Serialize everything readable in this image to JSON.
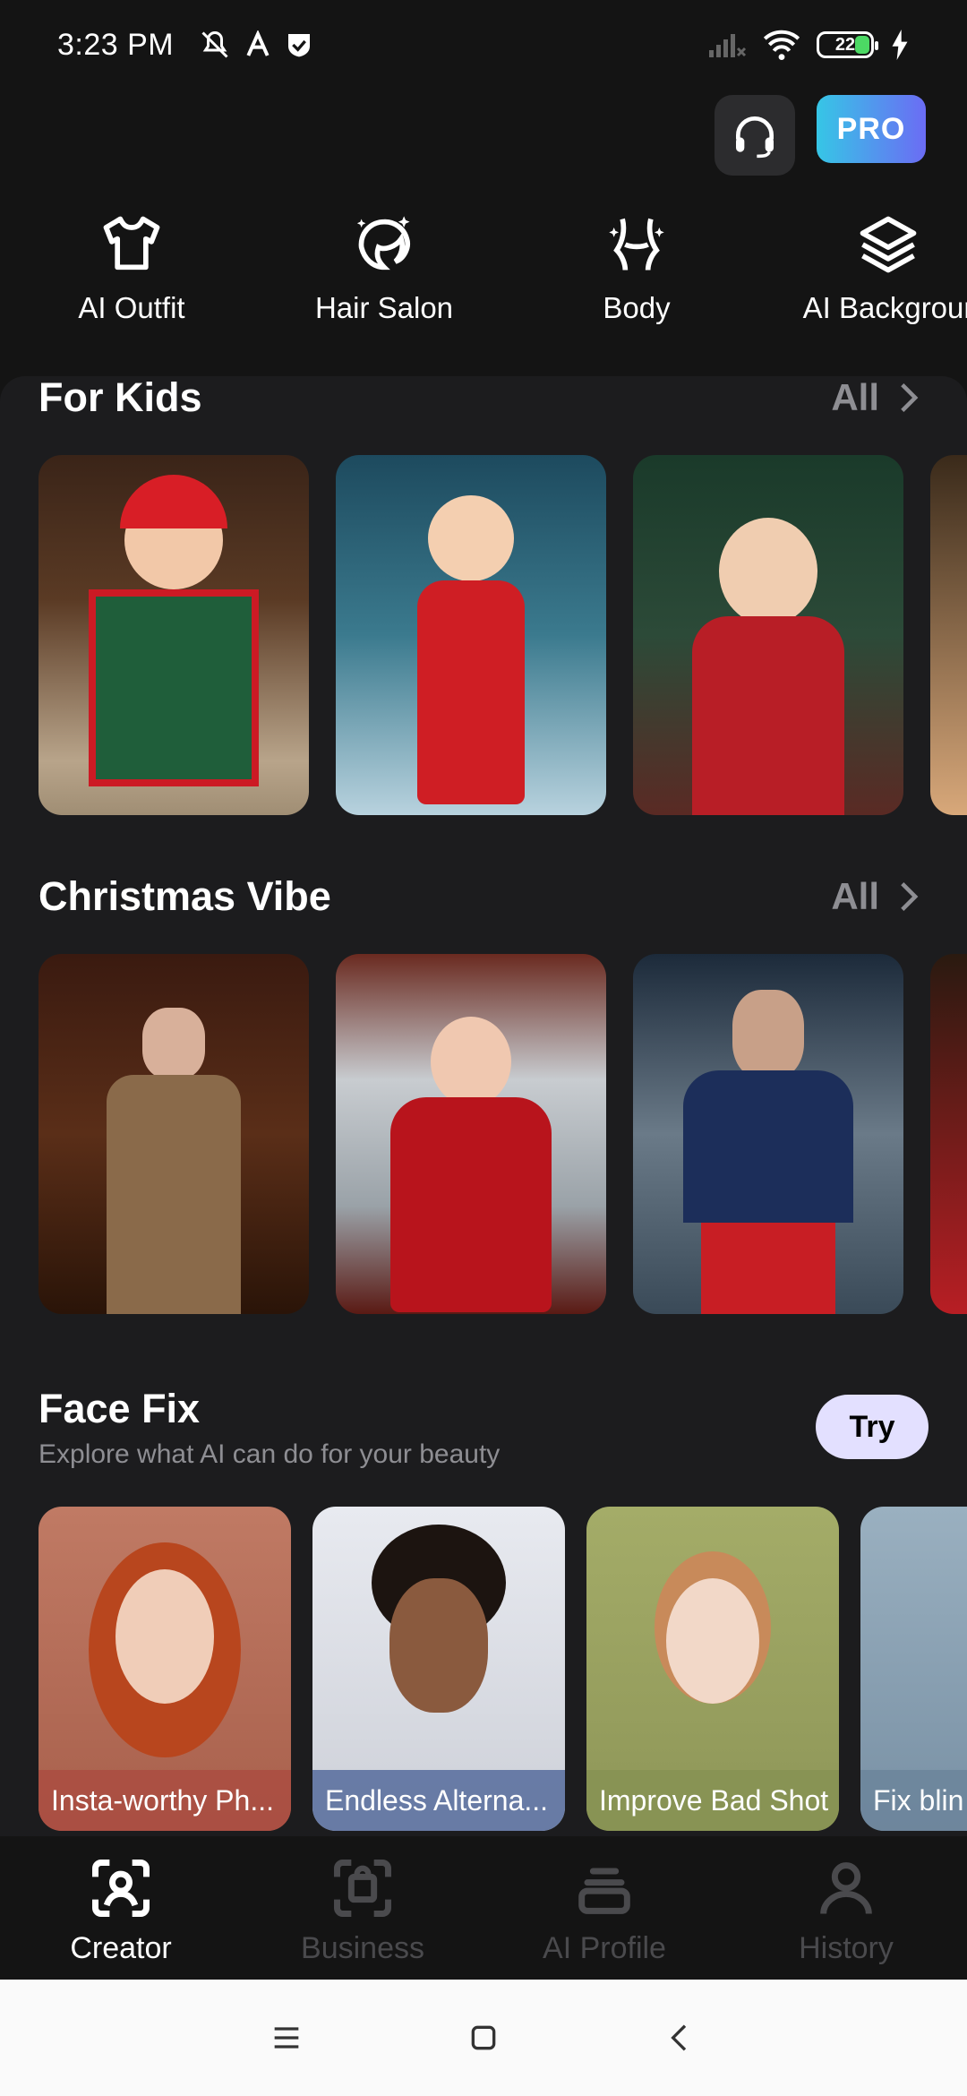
{
  "status": {
    "time": "3:23 PM",
    "battery": "22"
  },
  "header": {
    "pro_label": "PRO"
  },
  "tools": [
    {
      "label": "AI Outfit"
    },
    {
      "label": "Hair Salon"
    },
    {
      "label": "Body"
    },
    {
      "label": "AI Backgrour"
    }
  ],
  "sections": {
    "kids": {
      "title": "For Kids",
      "all_label": "All"
    },
    "christmas": {
      "title": "Christmas Vibe",
      "all_label": "All"
    },
    "facefix": {
      "title": "Face Fix",
      "subtitle": "Explore what AI can do for your beauty",
      "try_label": "Try",
      "cards": [
        {
          "caption": "Insta-worthy Ph..."
        },
        {
          "caption": "Endless Alterna..."
        },
        {
          "caption": "Improve Bad Shot"
        },
        {
          "caption": "Fix blin"
        }
      ]
    }
  },
  "bottom_nav": [
    {
      "label": "Creator"
    },
    {
      "label": "Business"
    },
    {
      "label": "AI Profile"
    },
    {
      "label": "History"
    }
  ]
}
